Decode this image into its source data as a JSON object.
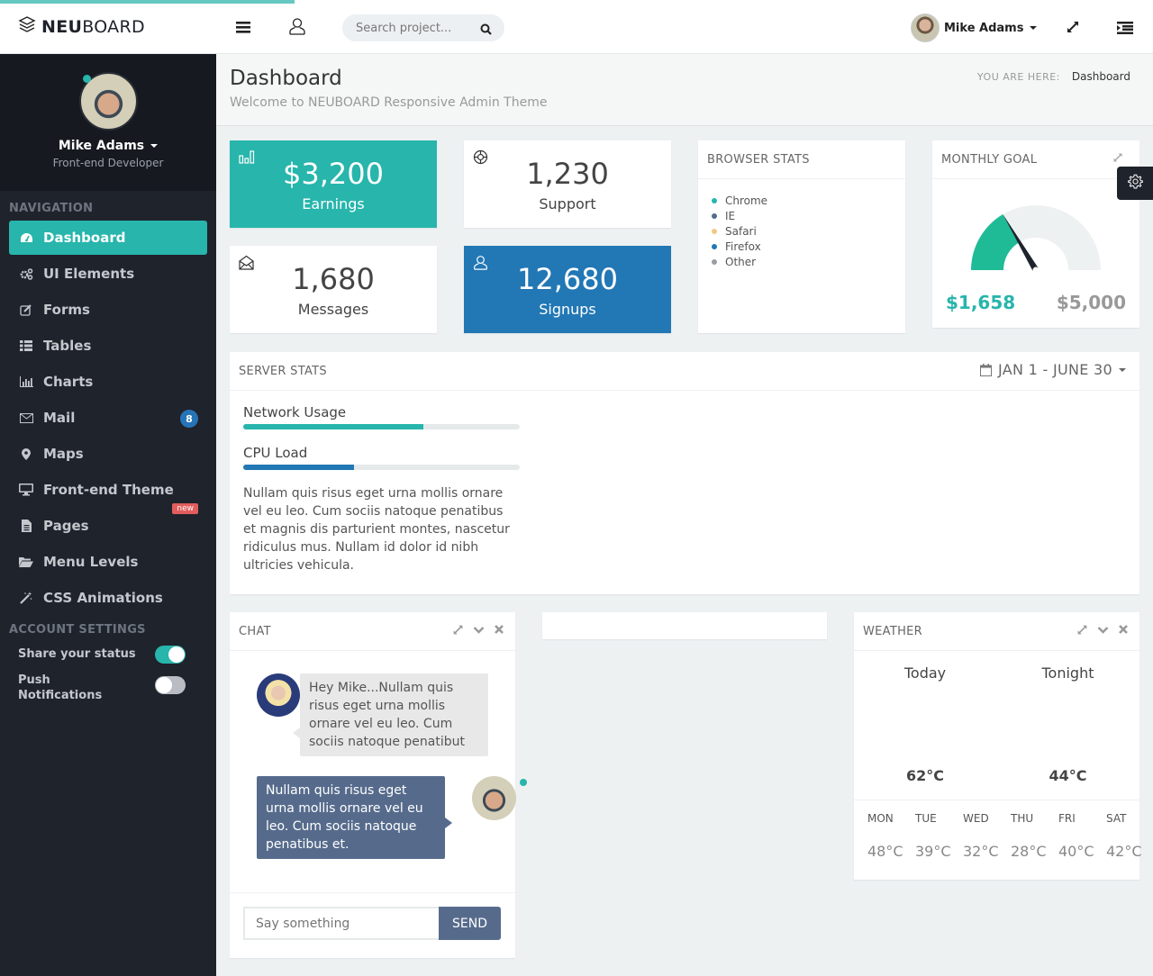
{
  "app": {
    "brand_bold": "NEU",
    "brand_rest": "BOARD"
  },
  "header": {
    "search_placeholder": "Search project...",
    "user_name": "Mike Adams"
  },
  "sidebar": {
    "profile": {
      "name": "Mike Adams",
      "role": "Front-end Developer"
    },
    "nav_heading": "NAVIGATION",
    "items": [
      {
        "label": "Dashboard",
        "icon": "dashboard-icon",
        "active": true
      },
      {
        "label": "UI Elements",
        "icon": "cogs-icon"
      },
      {
        "label": "Forms",
        "icon": "edit-icon"
      },
      {
        "label": "Tables",
        "icon": "list-icon"
      },
      {
        "label": "Charts",
        "icon": "bar-chart-icon"
      },
      {
        "label": "Mail",
        "icon": "envelope-icon",
        "badge": "8"
      },
      {
        "label": "Maps",
        "icon": "map-marker-icon"
      },
      {
        "label": "Front-end Theme",
        "icon": "desktop-icon",
        "tag": "new"
      },
      {
        "label": "Pages",
        "icon": "file-icon"
      },
      {
        "label": "Menu Levels",
        "icon": "folder-open-icon"
      },
      {
        "label": "CSS Animations",
        "icon": "magic-wand-icon"
      }
    ],
    "account_heading": "ACCOUNT SETTINGS",
    "settings": [
      {
        "label": "Share your status",
        "on": true
      },
      {
        "label": "Push Notifications",
        "on": false
      }
    ]
  },
  "page": {
    "title": "Dashboard",
    "subtitle": "Welcome to NEUBOARD Responsive Admin Theme",
    "breadcrumb_label": "YOU ARE HERE:",
    "breadcrumb_current": "Dashboard"
  },
  "tiles": [
    {
      "value": "$3,200",
      "label": "Earnings",
      "icon": "bar-chart-icon",
      "color": "#27b5ac"
    },
    {
      "value": "1,230",
      "label": "Support",
      "icon": "life-ring-icon",
      "color": "#ffffff"
    },
    {
      "value": "1,680",
      "label": "Messages",
      "icon": "envelope-open-icon",
      "color": "#ffffff"
    },
    {
      "value": "12,680",
      "label": "Signups",
      "icon": "user-icon",
      "color": "#2277b5"
    }
  ],
  "browser_stats": {
    "title": "BROWSER STATS",
    "legend": [
      {
        "name": "Chrome",
        "color": "#27b5ac"
      },
      {
        "name": "IE",
        "color": "#566b8c"
      },
      {
        "name": "Safari",
        "color": "#f0c984"
      },
      {
        "name": "Firefox",
        "color": "#2277b5"
      },
      {
        "name": "Other",
        "color": "#999ea5"
      }
    ]
  },
  "monthly_goal": {
    "title": "MONTHLY GOAL",
    "current": "$1,658",
    "target": "$5,000",
    "progress_fraction": 0.33
  },
  "server_stats": {
    "title": "SERVER STATS",
    "date_range": "JAN 1 - JUNE 30",
    "bars": [
      {
        "label": "Network Usage",
        "percent": 65,
        "color": "#27b5ac"
      },
      {
        "label": "CPU Load",
        "percent": 40,
        "color": "#2277b5"
      }
    ],
    "description": "Nullam quis risus eget urna mollis ornare vel eu leo. Cum sociis natoque penatibus et magnis dis parturient montes, nascetur ridiculus mus. Nullam id dolor id nibh ultricies vehicula."
  },
  "chat": {
    "title": "CHAT",
    "messages": [
      {
        "from": "other",
        "text": "Hey Mike...Nullam quis risus eget urna mollis ornare vel eu leo. Cum sociis natoque penatibut"
      },
      {
        "from": "me",
        "text": "Nullam quis risus eget urna mollis ornare vel eu leo. Cum sociis natoque penatibus et."
      }
    ],
    "input_placeholder": "Say something",
    "send_label": "SEND"
  },
  "weather": {
    "title": "WEATHER",
    "today_label": "Today",
    "tonight_label": "Tonight",
    "today_temp": "62°C",
    "tonight_temp": "44°C",
    "forecast": [
      {
        "day": "MON",
        "temp": "48°C"
      },
      {
        "day": "TUE",
        "temp": "39°C"
      },
      {
        "day": "WED",
        "temp": "32°C"
      },
      {
        "day": "THU",
        "temp": "28°C"
      },
      {
        "day": "FRI",
        "temp": "40°C"
      },
      {
        "day": "SAT",
        "temp": "42°C"
      }
    ]
  },
  "colors": {
    "accent": "#27b5ac",
    "blue": "#2277b5",
    "chat_me": "#566b8c",
    "sidebar": "#1f232c"
  }
}
